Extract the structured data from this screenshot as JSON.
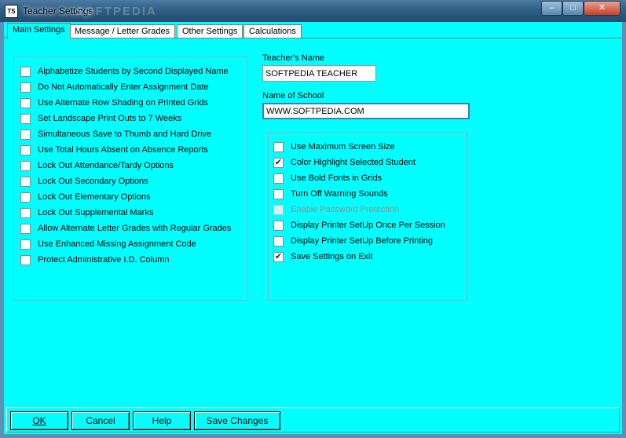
{
  "window": {
    "title": "Teacher Settings",
    "icon_text": "TS",
    "watermark": "SOFTPEDIA"
  },
  "tabs": [
    {
      "label": "Main Settings",
      "active": true
    },
    {
      "label": "Message / Letter Grades",
      "active": false
    },
    {
      "label": "Other Settings",
      "active": false
    },
    {
      "label": "Calculations",
      "active": false
    }
  ],
  "left_options": [
    {
      "label": "Alphabetize Students by Second Displayed Name",
      "checked": false
    },
    {
      "label": "Do Not Automatically Enter Assignment Date",
      "checked": false
    },
    {
      "label": "Use Alternate Row Shading on Printed Grids",
      "checked": false
    },
    {
      "label": "Set Landscape Print Outs to 7 Weeks",
      "checked": false
    },
    {
      "label": "Simultaneous Save to Thumb and Hard Drive",
      "checked": false
    },
    {
      "label": "Use Total Hours Absent on Absence Reports",
      "checked": false
    },
    {
      "label": "Lock Out Attendance/Tardy Options",
      "checked": false
    },
    {
      "label": "Lock Out Secondary Options",
      "checked": false
    },
    {
      "label": "Lock Out Elementary Options",
      "checked": false
    },
    {
      "label": "Lock Out Supplemental Marks",
      "checked": false
    },
    {
      "label": "Allow Alternate Letter Grades with Regular Grades",
      "checked": false
    },
    {
      "label": "Use Enhanced Missing Assignment Code",
      "checked": false
    },
    {
      "label": "Protect Administrative I.D. Column",
      "checked": false
    }
  ],
  "teacher_name": {
    "label": "Teacher's Name",
    "value": "SOFTPEDIA TEACHER"
  },
  "school_name": {
    "label": "Name of School",
    "value": "WWW.SOFTPEDIA.COM"
  },
  "right_options": [
    {
      "label": "Use Maximum Screen Size",
      "checked": false,
      "disabled": false
    },
    {
      "label": "Color Highlight Selected Student",
      "checked": true,
      "disabled": false
    },
    {
      "label": "Use Bold Fonts in Grids",
      "checked": false,
      "disabled": false
    },
    {
      "label": "Turn Off Warning Sounds",
      "checked": false,
      "disabled": false
    },
    {
      "label": "Enable Password Protection",
      "checked": false,
      "disabled": true
    },
    {
      "label": "Display Printer SetUp Once Per Session",
      "checked": false,
      "disabled": false
    },
    {
      "label": "Display Printer SetUp Before Printing",
      "checked": false,
      "disabled": false
    },
    {
      "label": "Save Settings on Exit",
      "checked": true,
      "disabled": false
    }
  ],
  "buttons": {
    "ok": "OK",
    "cancel": "Cancel",
    "help": "Help",
    "save": "Save Changes"
  },
  "colors": {
    "client_bg": "#00ffff",
    "title_bar": "#2f5f85",
    "close_button": "#c7402a"
  }
}
